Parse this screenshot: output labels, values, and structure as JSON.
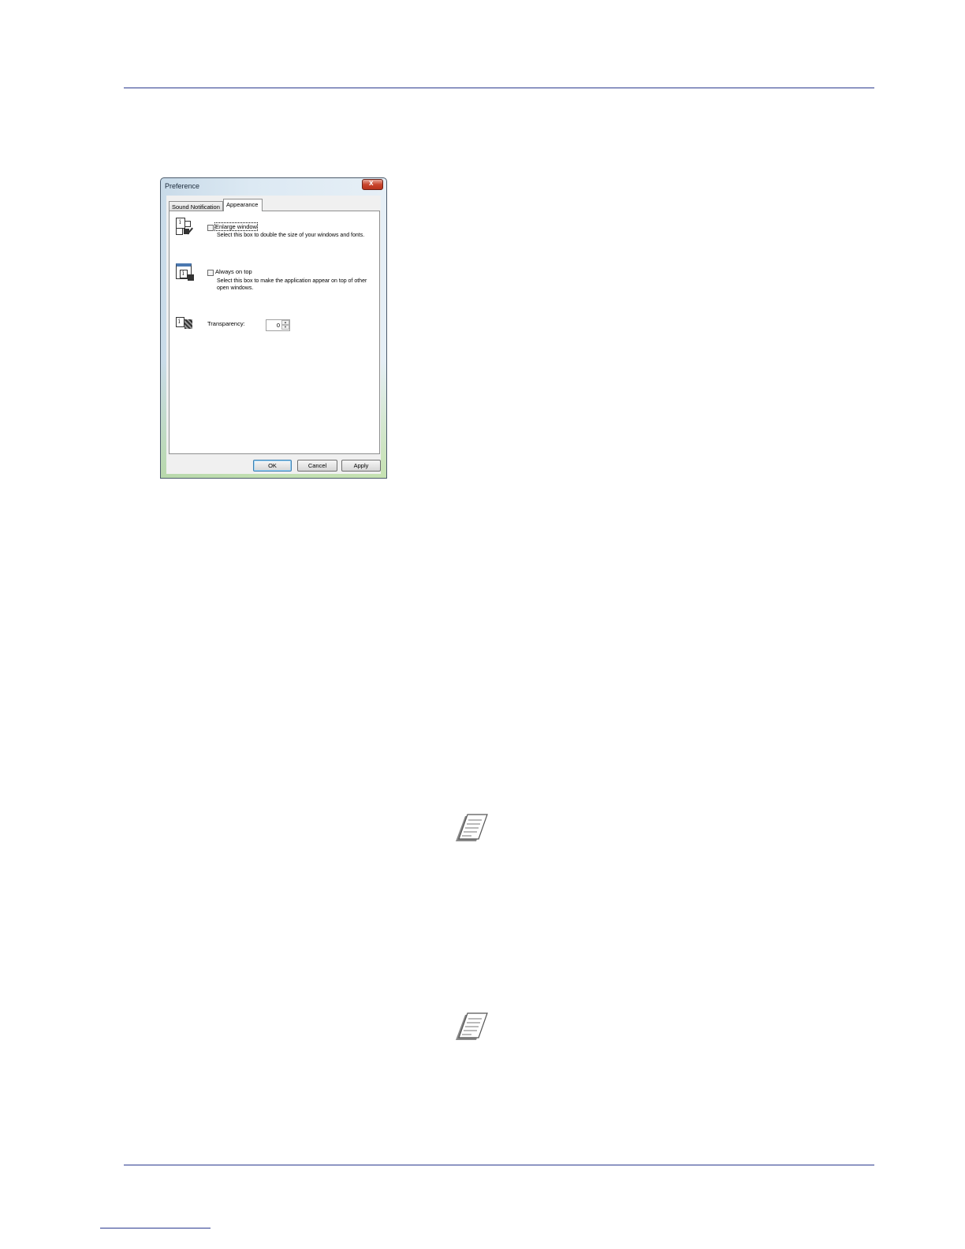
{
  "dialog": {
    "title": "Preference",
    "close_glyph": "x",
    "tabs": [
      {
        "label": "Sound Notification",
        "active": false
      },
      {
        "label": "Appearance",
        "active": true
      }
    ],
    "options": [
      {
        "label": "Enlarge window",
        "checked": false,
        "description": "Select this box to double the size of your windows and fonts.",
        "icon": "enlarge-window-icon"
      },
      {
        "label": "Always on top",
        "checked": false,
        "description": "Select this box to make the application appear on top of other open windows.",
        "icon": "always-on-top-icon"
      }
    ],
    "transparency": {
      "label": "Transparency:",
      "value": "0",
      "icon": "transparency-icon"
    },
    "buttons": {
      "ok": "OK",
      "cancel": "Cancel",
      "apply": "Apply"
    }
  },
  "notes": [
    {
      "icon": "note-icon"
    },
    {
      "icon": "note-icon"
    }
  ],
  "colors": {
    "rule": "#2b3a8f",
    "ok_border": "#3c7fb1"
  }
}
